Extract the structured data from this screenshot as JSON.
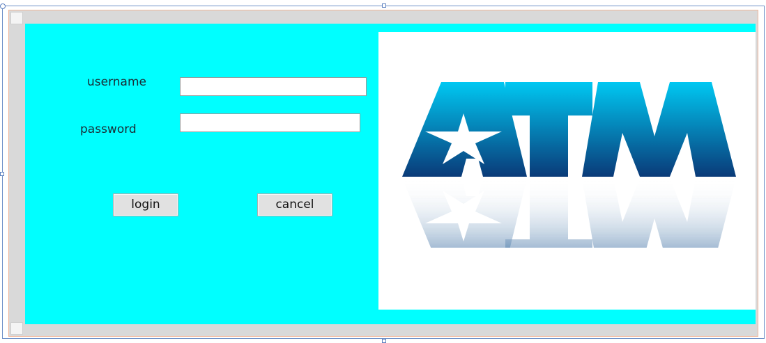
{
  "form": {
    "username_label": "username",
    "password_label": "password",
    "username_value": "",
    "password_value": "",
    "login_label": "login",
    "cancel_label": "cancel"
  },
  "logo": {
    "text": "ATM",
    "icon": "star-icon"
  },
  "colors": {
    "panel_background": "#00ffff",
    "logo_gradient_top": "#00c8f2",
    "logo_gradient_bottom": "#0a3a78"
  }
}
